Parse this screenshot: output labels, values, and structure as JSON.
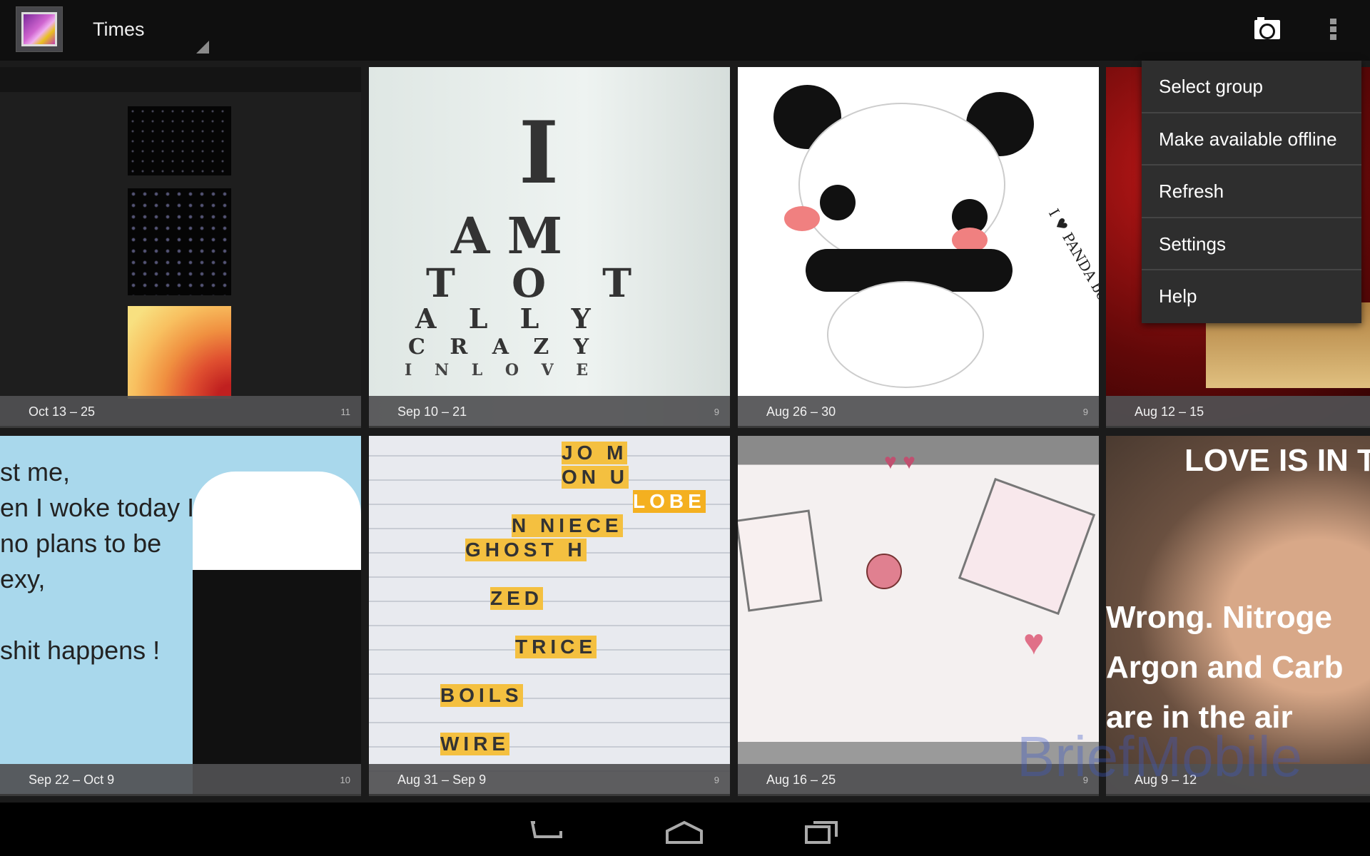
{
  "actionbar": {
    "title": "Times",
    "app_icon": "gallery-icon",
    "camera_icon": "camera-icon",
    "overflow_icon": "overflow-menu-icon"
  },
  "albums": [
    {
      "date": "Oct 13 – 25",
      "count": "11"
    },
    {
      "date": "Sep 10 – 21",
      "count": "9",
      "image_text": [
        "I",
        "A M",
        "T O T",
        "A L L Y",
        "C R A Z Y",
        "I N L O V E"
      ]
    },
    {
      "date": "Aug 26 – 30",
      "count": "9",
      "image_text": [
        "I ♥ PANDA bear"
      ]
    },
    {
      "date": "Aug 12 – 15",
      "count": ""
    },
    {
      "date": "Sep 22 – Oct 9",
      "count": "10",
      "image_text": [
        "st me,",
        "en I woke today I",
        "no plans to be",
        "exy,",
        "shit happens !"
      ]
    },
    {
      "date": "Aug 31 – Sep 9",
      "count": "9",
      "image_text": [
        "JO  M",
        "ON  U",
        "LOBE",
        "N NIECE",
        "GHOST H",
        "ZED",
        "TRICE",
        "BOILS",
        "WIRE"
      ]
    },
    {
      "date": "Aug 16 – 25",
      "count": "9"
    },
    {
      "date": "Aug 9 – 12",
      "count": "",
      "image_text": [
        "LOVE IS IN T",
        "Wrong. Nitroge",
        "Argon and Carb",
        "are in the air"
      ]
    }
  ],
  "overflow_menu": {
    "items": [
      "Select group",
      "Make available offline",
      "Refresh",
      "Settings",
      "Help"
    ]
  },
  "watermark": "BriefMobile",
  "navbar": {
    "back_icon": "back-icon",
    "home_icon": "home-icon",
    "recents_icon": "recent-apps-icon"
  }
}
